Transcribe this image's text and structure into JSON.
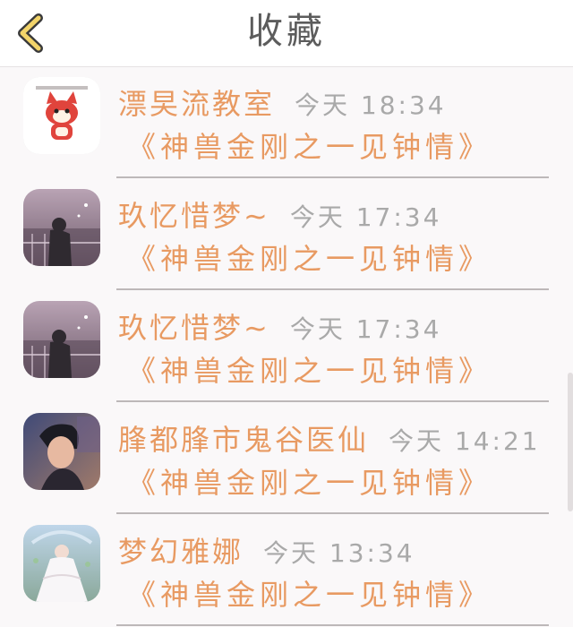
{
  "header": {
    "title": "收藏",
    "back_icon": "chevron-left-icon",
    "accent_color": "#f2d46a"
  },
  "items": [
    {
      "name": "漂旲流教室",
      "time": "今天 18:34",
      "work": "《神兽金刚之一见钟情》",
      "avatar": "cartoon-fox-avatar"
    },
    {
      "name": "玖忆惜梦~",
      "time": "今天 17:34",
      "work": "《神兽金刚之一见钟情》",
      "avatar": "girl-window-avatar"
    },
    {
      "name": "玖忆惜梦~",
      "time": "今天 17:34",
      "work": "《神兽金刚之一见钟情》",
      "avatar": "girl-window-avatar"
    },
    {
      "name": "䏺都䏺市鬼谷医仙",
      "time": "今天 14:21",
      "work": "《神兽金刚之一见钟情》",
      "avatar": "young-man-avatar"
    },
    {
      "name": "梦幻雅娜",
      "time": "今天 13:34",
      "work": "《神兽金刚之一见钟情》",
      "avatar": "bride-avatar"
    }
  ],
  "colors": {
    "name_text": "#e89a62",
    "time_text": "#a9a9a9"
  }
}
